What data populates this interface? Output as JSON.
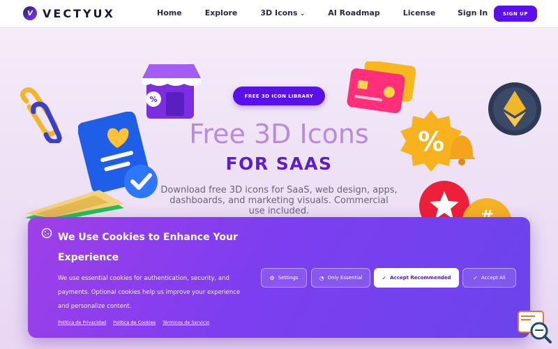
{
  "brand": {
    "name": "VECTYUX",
    "mark": "V"
  },
  "nav": {
    "links": [
      "Home",
      "Explore",
      "3D Icons",
      "AI Roadmap",
      "License"
    ],
    "signin": "Sign In",
    "signup": "SIGN UP"
  },
  "hero": {
    "badge": "FREE 3D ICON LIBRARY",
    "title": "Free 3D Icons",
    "subtitle": "FOR SAAS",
    "description": "Download free 3D icons for SaaS, web design, apps, dashboards, and marketing visuals. Commercial use included."
  },
  "cookie": {
    "title": "We Use Cookies to Enhance Your Experience",
    "text": "We use essential cookies for authentication, security, and payments. Optional cookies help us improve your experience and personalize content.",
    "buttons": {
      "settings": "Settings",
      "essential": "Only Essential",
      "recommended": "Accept Recommended",
      "all": "Accept All"
    },
    "links": [
      "Política de Privacidad",
      "Política de Cookies",
      "Términos de Servicio"
    ]
  },
  "colors": {
    "accent": "#5a10e8",
    "cookie_bg": "#7d3ef0"
  },
  "icons": [
    "paperclip-icon",
    "store-icon",
    "credit-card-icon",
    "ethereum-coin-icon",
    "document-heart-icon",
    "percent-badge-icon",
    "bell-icon",
    "star-badge-icon",
    "hashtag-badge-icon",
    "money-stack-icon"
  ]
}
